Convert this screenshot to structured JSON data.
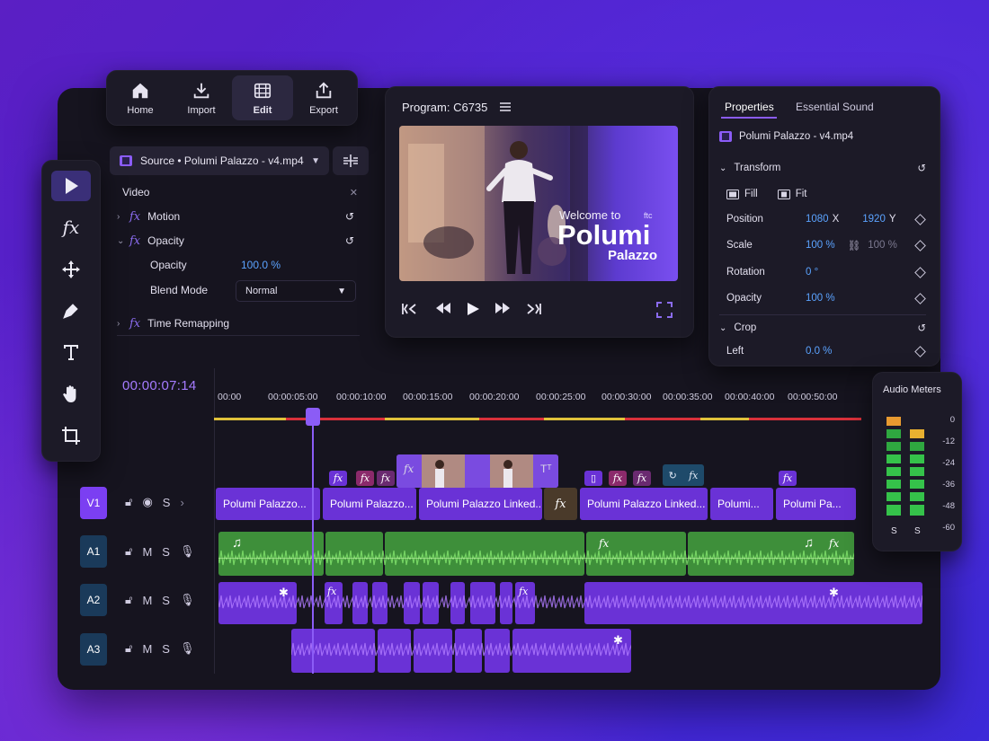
{
  "nav": {
    "items": [
      {
        "label": "Home",
        "icon": "home-icon"
      },
      {
        "label": "Import",
        "icon": "download-icon"
      },
      {
        "label": "Edit",
        "icon": "film-icon",
        "active": true
      },
      {
        "label": "Export",
        "icon": "share-icon"
      }
    ]
  },
  "tools": [
    "selection-tool-icon",
    "fx-tool-icon",
    "move-tool-icon",
    "pen-tool-icon",
    "type-tool-icon",
    "hand-tool-icon",
    "crop-tool-icon"
  ],
  "effect_controls": {
    "source_label": "Source • Polumi Palazzo - v4.mp4",
    "section": "Video",
    "motion": "Motion",
    "opacity_group": "Opacity",
    "opacity_label": "Opacity",
    "opacity_value": "100.0 %",
    "blend_label": "Blend Mode",
    "blend_value": "Normal",
    "time_remap": "Time Remapping"
  },
  "program": {
    "title": "Program: C6735",
    "overlay_welcome": "Welcome to",
    "overlay_title": "Polumi",
    "overlay_sub": "Palazzo",
    "overlay_logo": "ftc"
  },
  "properties": {
    "tabs": [
      "Properties",
      "Essential Sound"
    ],
    "file": "Polumi Palazzo - v4.mp4",
    "transform": "Transform",
    "fill": "Fill",
    "fit": "Fit",
    "position_label": "Position",
    "position_x": "1080",
    "x_unit": "X",
    "position_y": "1920",
    "y_unit": "Y",
    "scale_label": "Scale",
    "scale_value": "100 %",
    "scale_value2": "100 %",
    "rotation_label": "Rotation",
    "rotation_value": "0 °",
    "opacity_label": "Opacity",
    "opacity_value": "100 %",
    "crop": "Crop",
    "left_label": "Left",
    "left_value": "0.0 %"
  },
  "timeline": {
    "timecode": "00:00:07:14",
    "ruler": [
      "00:00",
      "00:00:05:00",
      "00:00:10:00",
      "00:00:15:00",
      "00:00:20:00",
      "00:00:25:00",
      "00:00:30:00",
      "00:00:35:00",
      "00:00:40:00",
      "00:00:50:00"
    ],
    "tracks": [
      {
        "label": "V1",
        "controls": [
          "S"
        ]
      },
      {
        "label": "A1",
        "controls": [
          "M",
          "S"
        ]
      },
      {
        "label": "A2",
        "controls": [
          "M",
          "S"
        ]
      },
      {
        "label": "A3",
        "controls": [
          "M",
          "S"
        ]
      }
    ],
    "video_clips": [
      "Polumi Palazzo...",
      "Polumi Palazzo...",
      "Polumi Palazzo Linked...",
      "Polumi Palazzo Linked...",
      "Polumi...",
      "Polumi Pa..."
    ]
  },
  "meters": {
    "title": "Audio Meters",
    "scale": [
      "0",
      "-12",
      "-24",
      "-36",
      "-48",
      "-60"
    ],
    "solo": [
      "S",
      "S"
    ]
  },
  "colors": {
    "accent": "#7b3ff2",
    "value_blue": "#5ba3ff",
    "audio_green": "#3e8f3a",
    "audio_purple": "#6a32d6"
  }
}
